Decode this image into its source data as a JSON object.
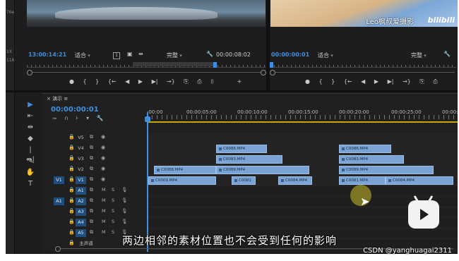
{
  "left_strip": {
    "labels": [
      "76e",
      "1X",
      "116"
    ]
  },
  "source_monitor": {
    "timecode": "13:00:14:21",
    "zoom": "适合",
    "sq_label": "1",
    "quality": "完整",
    "duration": "00:00:08:02"
  },
  "program_monitor": {
    "watermark": "Leo枫叔爱摄影",
    "logo": "bilibili",
    "timecode": "00:00:00:01",
    "zoom": "适合",
    "quality": "完整"
  },
  "transport": {
    "source": [
      "●",
      "{",
      "}",
      "{←",
      "◀",
      "▶",
      "▶|",
      "→}",
      "⎘",
      "⎙",
      "⌷",
      "+"
    ],
    "program": [
      "●",
      "{",
      "}",
      "{←",
      "◀",
      "▶",
      "▶|",
      "→}",
      "⎘",
      "⎙"
    ]
  },
  "tools": [
    "▶",
    "⇤",
    "⇹",
    "◆",
    "|↔|",
    "✎",
    "✋",
    "T"
  ],
  "sequence": {
    "tab_label": "× 演示 ≡",
    "timecode": "00:00:00:01",
    "icons": [
      "⤖",
      "∩",
      "⊦",
      "▾",
      "🔧"
    ],
    "ruler_labels": [
      ":00:00",
      "00:00:05:00",
      "00:00:10:00",
      "00:00:15:00",
      "00:00:20:00",
      "00:00:25:00",
      "00:00:30"
    ],
    "master_label": "主声道"
  },
  "video_tracks": [
    {
      "name": "V5",
      "src": "",
      "target": false
    },
    {
      "name": "V4",
      "src": "",
      "target": false
    },
    {
      "name": "V3",
      "src": "",
      "target": false
    },
    {
      "name": "V2",
      "src": "",
      "target": false
    },
    {
      "name": "V1",
      "src": "V1",
      "target": true
    }
  ],
  "audio_tracks": [
    {
      "name": "A1",
      "src": ""
    },
    {
      "name": "A2",
      "src": "A1"
    },
    {
      "name": "A3",
      "src": ""
    },
    {
      "name": "A4",
      "src": ""
    },
    {
      "name": "A5",
      "src": ""
    }
  ],
  "audio_controls": {
    "mute": "M",
    "solo": "S"
  },
  "clips": [
    {
      "track": "V4",
      "label": "C0086.MP4"
    },
    {
      "track": "V3",
      "label": "C0083.MP4"
    },
    {
      "track": "V2",
      "label": "C0088.MP4"
    },
    {
      "track": "V2",
      "label": "C0089.MP4"
    },
    {
      "track": "V1",
      "label": "C0009.MP4"
    },
    {
      "track": "V1",
      "label": "C0081"
    },
    {
      "track": "V1",
      "label": "C0084.MP4"
    },
    {
      "track": "V4",
      "label": "C0086.MP4"
    },
    {
      "track": "V3",
      "label": "C0083.MP4"
    },
    {
      "track": "V2",
      "label": "C0089.MP4"
    },
    {
      "track": "V1",
      "label": "C0081.MP4"
    },
    {
      "track": "V1",
      "label": "C0084.MP4"
    }
  ],
  "subtitle": "两边相邻的素材位置也不会受到任何的影响",
  "watermark": "CSDN @yanghuagai2311"
}
